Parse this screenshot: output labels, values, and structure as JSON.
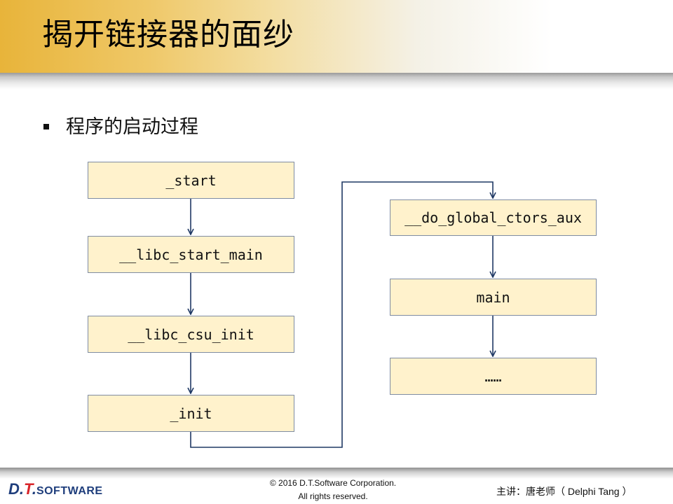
{
  "slide": {
    "title": "揭开链接器的面纱",
    "bullet": "程序的启动过程"
  },
  "diagram": {
    "left_column": [
      "_start",
      "__libc_start_main",
      "__libc_csu_init",
      "_init"
    ],
    "right_column": [
      "__do_global_ctors_aux",
      "main",
      "……"
    ]
  },
  "footer": {
    "logo_dt": "D.T.",
    "logo_software": "SOFTWARE",
    "copyright_line1": "© 2016 D.T.Software Corporation.",
    "copyright_line2": "All rights reserved.",
    "presenter": "主讲：唐老师（ Delphi Tang ）"
  },
  "colors": {
    "box_fill": "#fff2cc",
    "box_border": "#7f8ca2",
    "arrow": "#1f3864",
    "title_gradient_start": "#e8b43a",
    "logo_blue": "#1f3e7c",
    "logo_red": "#d8262b"
  }
}
